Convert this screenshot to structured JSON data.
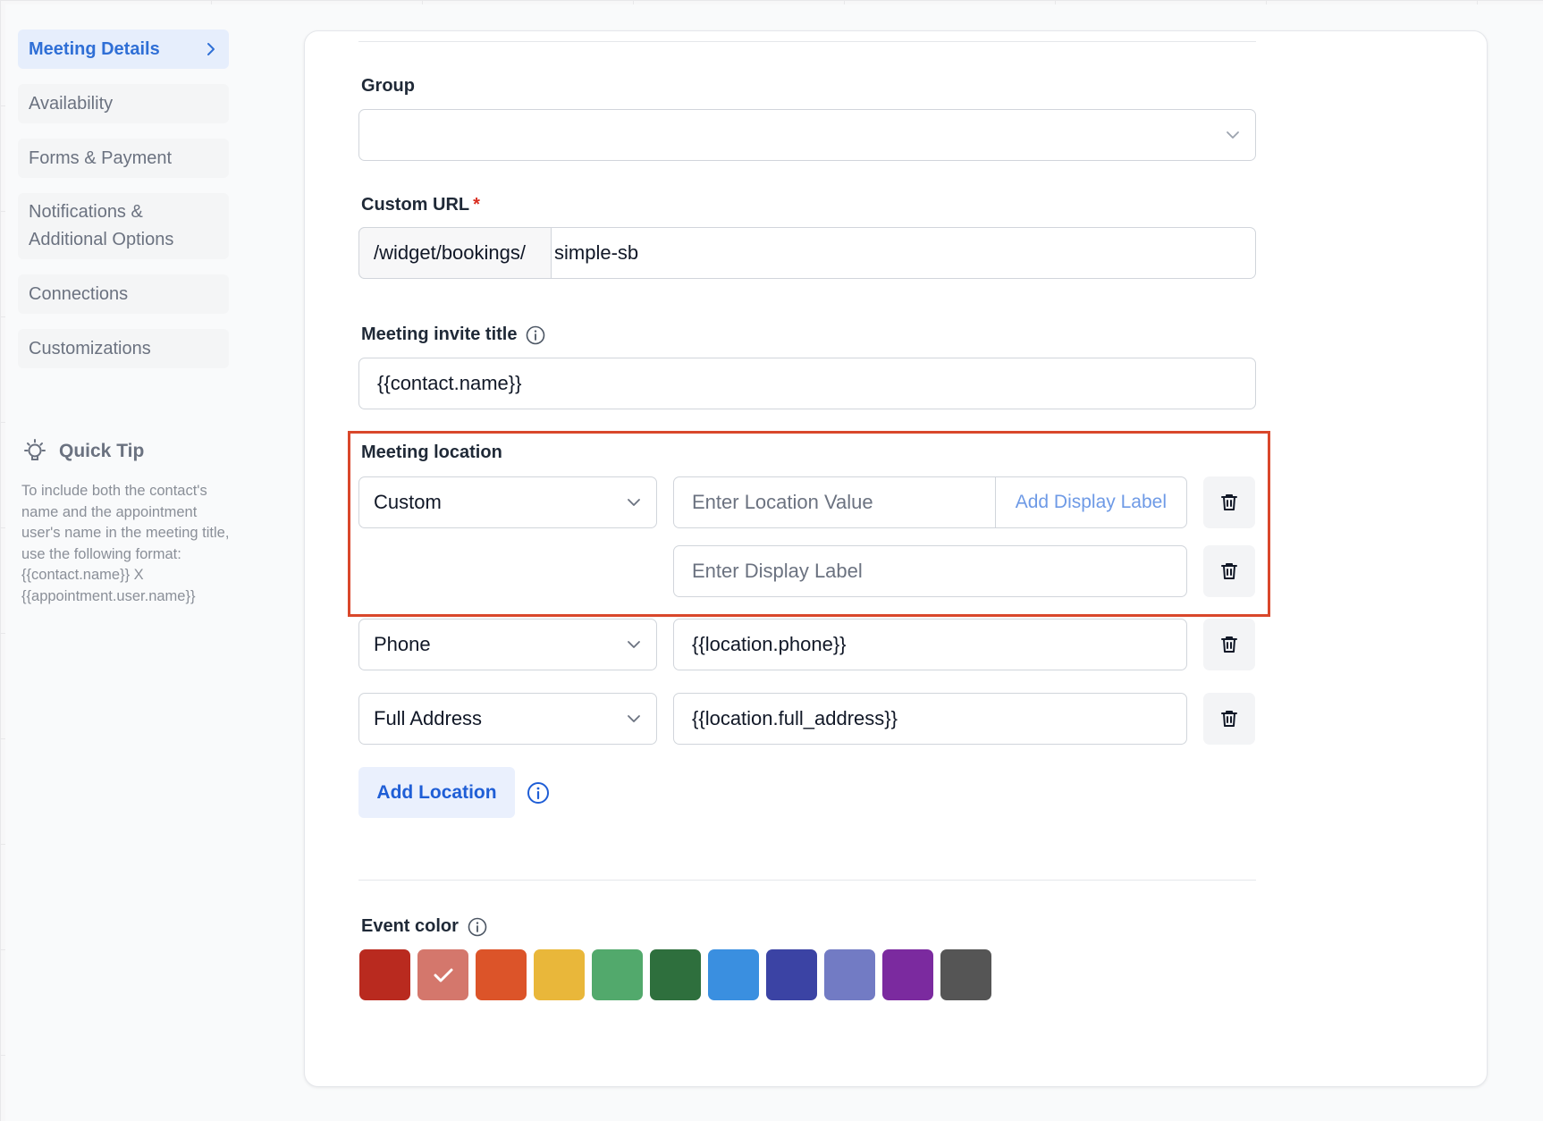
{
  "sidebar": {
    "items": [
      {
        "label": "Meeting Details"
      },
      {
        "label": "Availability"
      },
      {
        "label": "Forms & Payment"
      },
      {
        "label": "Notifications &\nAdditional Options"
      },
      {
        "label": "Connections"
      },
      {
        "label": "Customizations"
      }
    ],
    "quick_tip": {
      "title": "Quick Tip",
      "text": "To include both the contact's name and the appointment user's name in the meeting title, use the following format: {{contact.name}} X {{appointment.user.name}}"
    }
  },
  "form": {
    "group": {
      "label": "Group",
      "value": ""
    },
    "custom_url": {
      "label": "Custom URL",
      "required_mark": "*",
      "prefix": "/widget/bookings/",
      "value": "simple-sb"
    },
    "invite_title": {
      "label": "Meeting invite title",
      "value": "{{contact.name}}"
    },
    "meeting_location": {
      "label": "Meeting location",
      "rows": [
        {
          "type": "Custom",
          "value_placeholder": "Enter Location Value",
          "add_label": "Add Display Label",
          "display_placeholder": "Enter Display Label"
        },
        {
          "type": "Phone",
          "value": "{{location.phone}}"
        },
        {
          "type": "Full Address",
          "value": "{{location.full_address}}"
        }
      ],
      "add_button": "Add Location"
    },
    "event_color": {
      "label": "Event color",
      "colors": [
        "#b92a1f",
        "#d4776c",
        "#dc5429",
        "#e9b73a",
        "#52a96c",
        "#2e6f3d",
        "#3a8fe0",
        "#3b43a4",
        "#727bc4",
        "#7b2a9f",
        "#555555"
      ],
      "selected_index": 1
    }
  }
}
